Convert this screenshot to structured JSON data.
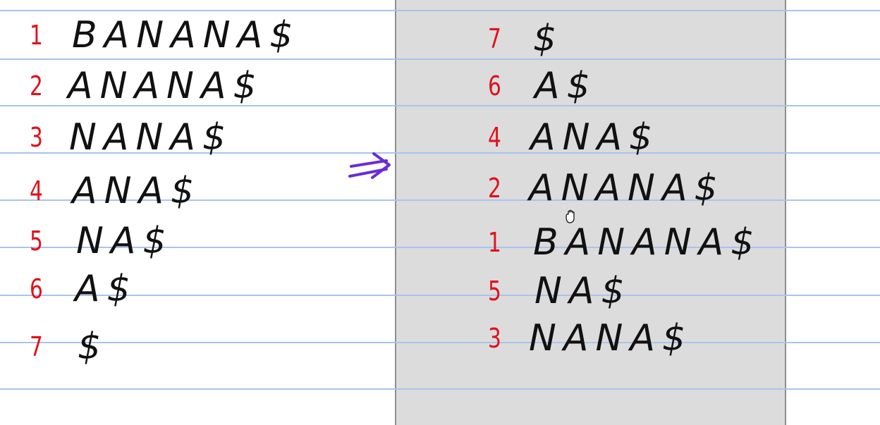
{
  "colors": {
    "rule_line": "#a9c4ec",
    "index_number": "#e0121c",
    "suffix_text": "#111111",
    "panel_background": "#dcdcdc",
    "arrow": "#6a2cd8"
  },
  "left_list": [
    {
      "index": "1",
      "suffix": "BANANA$"
    },
    {
      "index": "2",
      "suffix": "ANANA$"
    },
    {
      "index": "3",
      "suffix": "NANA$"
    },
    {
      "index": "4",
      "suffix": "ANA$"
    },
    {
      "index": "5",
      "suffix": "NA$"
    },
    {
      "index": "6",
      "suffix": "A$"
    },
    {
      "index": "7",
      "suffix": "$"
    }
  ],
  "right_list": [
    {
      "index": "7",
      "suffix": "$"
    },
    {
      "index": "6",
      "suffix": "A$"
    },
    {
      "index": "4",
      "suffix": "ANA$"
    },
    {
      "index": "2",
      "suffix": "ANANA$"
    },
    {
      "index": "1",
      "suffix": "BANANA$"
    },
    {
      "index": "5",
      "suffix": "NA$"
    },
    {
      "index": "3",
      "suffix": "NANA$"
    }
  ],
  "icons": {
    "arrow": "double-right-arrow-icon",
    "cursor": "hand-cursor-icon"
  }
}
